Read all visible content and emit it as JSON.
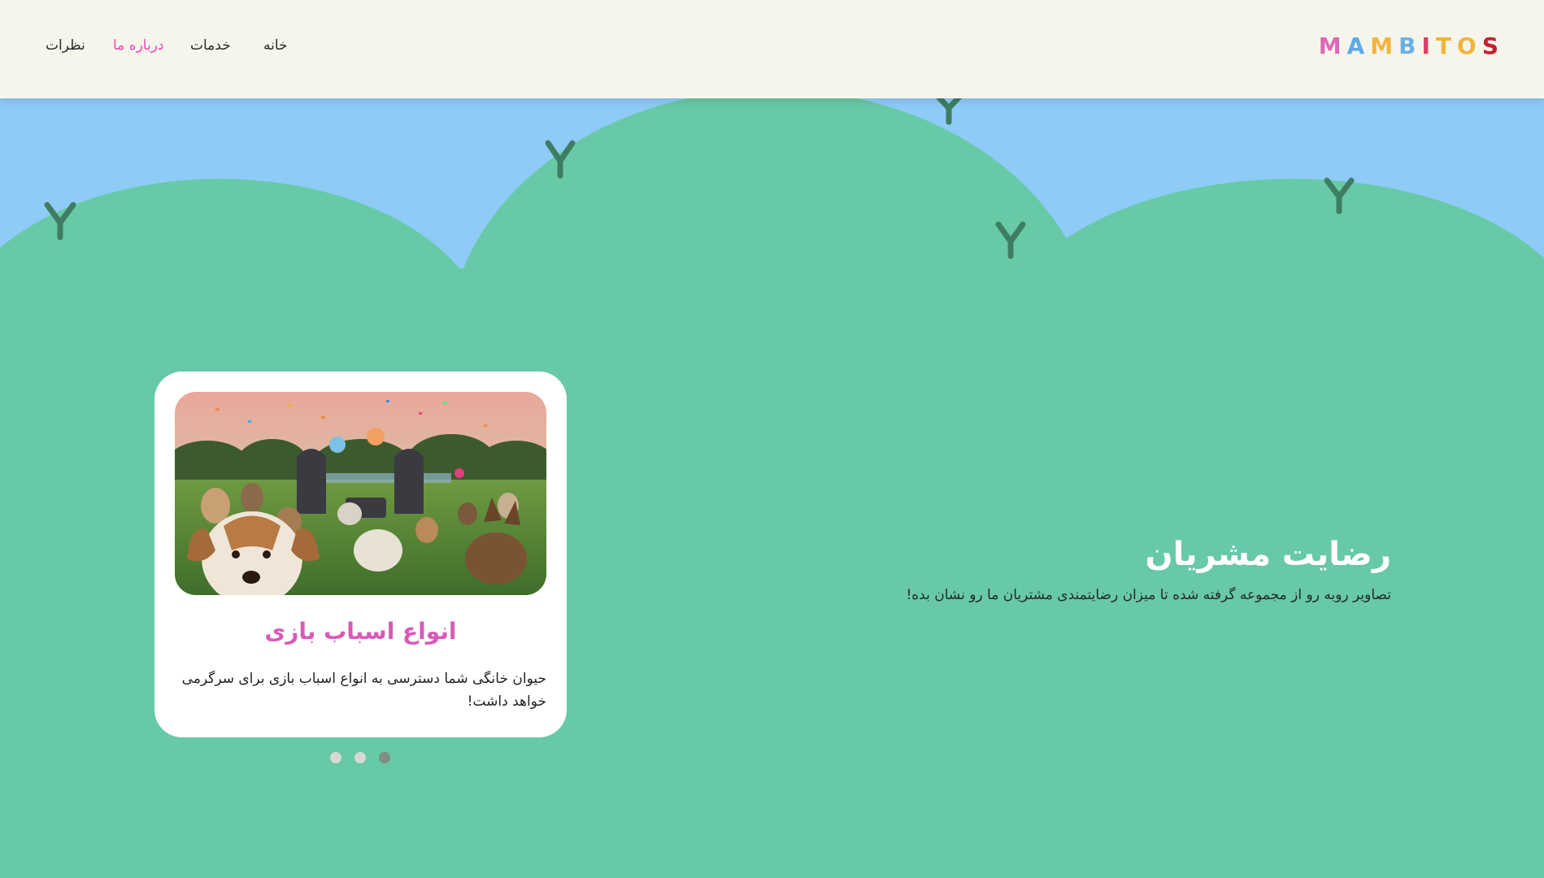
{
  "brand": {
    "logo_letters": [
      {
        "char": "M",
        "color": "#e066b7"
      },
      {
        "char": "A",
        "color": "#5fa9e6"
      },
      {
        "char": "M",
        "color": "#f2b43c"
      },
      {
        "char": "B",
        "color": "#6ab0e8"
      },
      {
        "char": "I",
        "color": "#e33b66"
      },
      {
        "char": "T",
        "color": "#f0b534"
      },
      {
        "char": "O",
        "color": "#f2b43c"
      },
      {
        "char": "S",
        "color": "#c8202e"
      }
    ]
  },
  "nav": {
    "items": [
      {
        "label": "نظرات",
        "active": false
      },
      {
        "label": "درباره ما",
        "active": true
      },
      {
        "label": "خدمات",
        "active": false
      },
      {
        "label": "خانه",
        "active": false
      }
    ]
  },
  "hero": {
    "title": "رضایت مشریان",
    "subtitle": "تصاویر روبه رو از مجموعه گرفته شده تا میزان رضایتمندی مشتریان ما رو نشان بده!"
  },
  "card": {
    "title": "انواع اسباب بازی",
    "description": "حیوان خانگی شما دسترسی به انواع اسباب بازی برای سرگرمی خواهد داشت!",
    "image_alt": "dogs party"
  },
  "carousel": {
    "count": 3,
    "active_index": 2
  },
  "colors": {
    "sky": "#8ecbf7",
    "hills": "#68c9a7",
    "header_bg": "#f6f5ec",
    "accent": "#e54bb0",
    "sprout": "#3a7a5f"
  }
}
